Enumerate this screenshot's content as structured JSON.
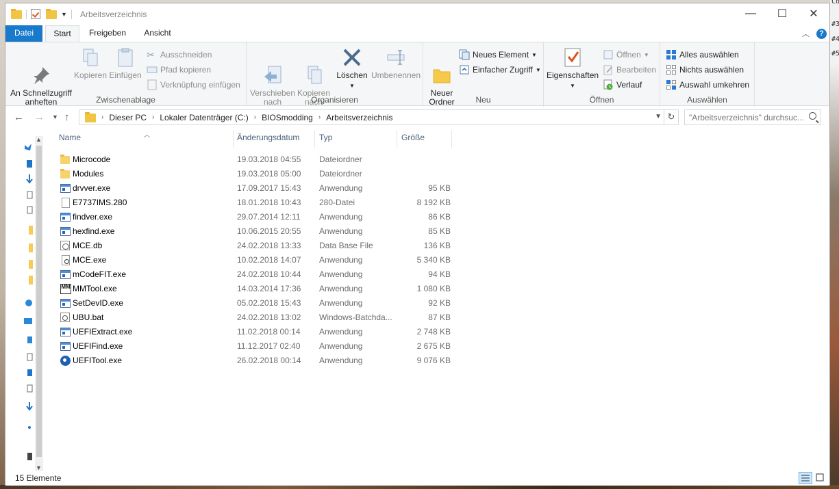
{
  "window": {
    "title": "Arbeitsverzeichnis"
  },
  "ribbon_tabs": [
    {
      "label": "Datei"
    },
    {
      "label": "Start"
    },
    {
      "label": "Freigeben"
    },
    {
      "label": "Ansicht"
    }
  ],
  "ribbon": {
    "zwischenablage": {
      "label": "Zwischenablage",
      "pin": "An Schnellzugriff\nanheften",
      "copy": "Kopieren",
      "paste": "Einfügen",
      "cut": "Ausschneiden",
      "copy_path": "Pfad kopieren",
      "paste_shortcut": "Verknüpfung einfügen"
    },
    "organisieren": {
      "label": "Organisieren",
      "move_to": "Verschieben\nnach",
      "copy_to": "Kopieren\nnach",
      "delete": "Löschen",
      "rename": "Umbenennen"
    },
    "neu": {
      "label": "Neu",
      "new_folder": "Neuer\nOrdner",
      "new_item": "Neues Element",
      "easy_access": "Einfacher Zugriff"
    },
    "oeffnen": {
      "label": "Öffnen",
      "properties": "Eigenschaften",
      "open": "Öffnen",
      "edit": "Bearbeiten",
      "history": "Verlauf"
    },
    "auswaehlen": {
      "label": "Auswählen",
      "select_all": "Alles auswählen",
      "select_none": "Nichts auswählen",
      "invert": "Auswahl umkehren"
    }
  },
  "address": {
    "crumbs": [
      "Dieser PC",
      "Lokaler Datenträger (C:)",
      "BIOSmodding",
      "Arbeitsverzeichnis"
    ],
    "search_placeholder": "\"Arbeitsverzeichnis\" durchsuc..."
  },
  "columns": {
    "name": "Name",
    "date": "Änderungsdatum",
    "type": "Typ",
    "size": "Größe"
  },
  "files": [
    {
      "icon": "folder",
      "name": "Microcode",
      "date": "19.03.2018 04:55",
      "type": "Dateiordner",
      "size": ""
    },
    {
      "icon": "folder",
      "name": "Modules",
      "date": "19.03.2018 05:00",
      "type": "Dateiordner",
      "size": ""
    },
    {
      "icon": "exe",
      "name": "drvver.exe",
      "date": "17.09.2017 15:43",
      "type": "Anwendung",
      "size": "95 KB"
    },
    {
      "icon": "doc",
      "name": "E7737IMS.280",
      "date": "18.01.2018 10:43",
      "type": "280-Datei",
      "size": "8 192 KB"
    },
    {
      "icon": "exe",
      "name": "findver.exe",
      "date": "29.07.2014 12:11",
      "type": "Anwendung",
      "size": "86 KB"
    },
    {
      "icon": "exe",
      "name": "hexfind.exe",
      "date": "10.06.2015 20:55",
      "type": "Anwendung",
      "size": "85 KB"
    },
    {
      "icon": "db",
      "name": "MCE.db",
      "date": "24.02.2018 13:33",
      "type": "Data Base File",
      "size": "136 KB"
    },
    {
      "icon": "mce",
      "name": "MCE.exe",
      "date": "10.02.2018 14:07",
      "type": "Anwendung",
      "size": "5 340 KB"
    },
    {
      "icon": "exe",
      "name": "mCodeFIT.exe",
      "date": "24.02.2018 10:44",
      "type": "Anwendung",
      "size": "94 KB"
    },
    {
      "icon": "mm",
      "name": "MMTool.exe",
      "date": "14.03.2014 17:36",
      "type": "Anwendung",
      "size": "1 080 KB"
    },
    {
      "icon": "exe",
      "name": "SetDevID.exe",
      "date": "05.02.2018 15:43",
      "type": "Anwendung",
      "size": "92 KB"
    },
    {
      "icon": "bat",
      "name": "UBU.bat",
      "date": "24.02.2018 13:02",
      "type": "Windows-Batchda...",
      "size": "87 KB"
    },
    {
      "icon": "exe",
      "name": "UEFIExtract.exe",
      "date": "11.02.2018 00:14",
      "type": "Anwendung",
      "size": "2 748 KB"
    },
    {
      "icon": "exe",
      "name": "UEFIFind.exe",
      "date": "11.12.2017 02:40",
      "type": "Anwendung",
      "size": "2 675 KB"
    },
    {
      "icon": "gear",
      "name": "UEFITool.exe",
      "date": "26.02.2018 00:14",
      "type": "Anwendung",
      "size": "9 076 KB"
    }
  ],
  "status": {
    "count": "15 Elemente"
  },
  "colors": {
    "accent": "#1979ca",
    "header_text": "#4c607a",
    "folder": "#f7d46b"
  }
}
